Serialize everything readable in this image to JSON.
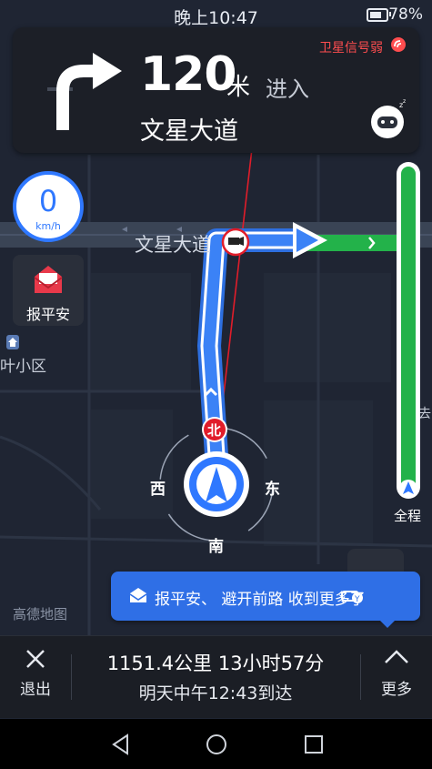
{
  "status_bar": {
    "time": "晚上10:47",
    "battery_percent": "78%",
    "battery_level": 0.78
  },
  "nav": {
    "distance": "120",
    "distance_unit": "米",
    "action": "进入",
    "road": "文星大道",
    "gps_status": "卫星信号弱"
  },
  "speed": {
    "value": "0",
    "unit": "km/h"
  },
  "safety_button": {
    "label": "报平安"
  },
  "map": {
    "road_label": "文星大道",
    "poi_label": "叶小区",
    "watermark": "高德地图",
    "edge_text": "去"
  },
  "compass": {
    "north": "北",
    "south": "南",
    "east": "东",
    "west": "西"
  },
  "progress": {
    "overview_label": "全程"
  },
  "tip": {
    "text": "报平安、  避开前路 收到更多了"
  },
  "bottom": {
    "exit_label": "退出",
    "trip_summary": "1151.4公里 13小时57分",
    "eta": "明天中午12:43到达",
    "more_label": "更多"
  },
  "colors": {
    "route_blue": "#3b82f6",
    "accent_blue": "#2f78ff",
    "green": "#23b24a",
    "warning_red": "#ff4d4f",
    "background": "#1f2533"
  }
}
